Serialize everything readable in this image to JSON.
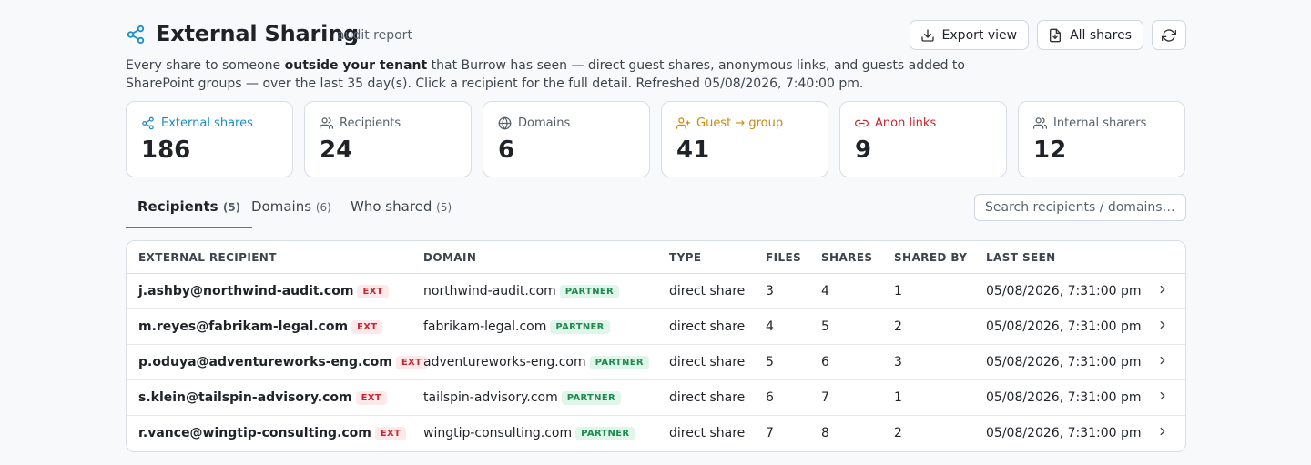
{
  "header": {
    "title": "External Sharing",
    "subtitle": "audit report",
    "export_label": "Export view",
    "all_shares_label": "All shares"
  },
  "description": {
    "part1": "Every share to someone ",
    "bold": "outside your tenant",
    "part2": " that Burrow has seen — direct guest shares, anonymous links, and guests added to SharePoint groups — over the last 35 day(s). Click a recipient for the full detail. Refreshed 05/08/2026, 7:40:00 pm."
  },
  "stats": [
    {
      "label": "External shares",
      "value": "186",
      "color": "#1a8fc7",
      "icon": "share-icon"
    },
    {
      "label": "Recipients",
      "value": "24",
      "color": "#57606a",
      "icon": "users-icon"
    },
    {
      "label": "Domains",
      "value": "6",
      "color": "#57606a",
      "icon": "globe-icon"
    },
    {
      "label": "Guest → group",
      "value": "41",
      "color": "#c98a0d",
      "icon": "user-plus-icon"
    },
    {
      "label": "Anon links",
      "value": "9",
      "color": "#c62832",
      "icon": "link-icon"
    },
    {
      "label": "Internal sharers",
      "value": "12",
      "color": "#57606a",
      "icon": "users-icon"
    }
  ],
  "tabs": [
    {
      "label": "Recipients",
      "count": "(5)",
      "active": true
    },
    {
      "label": "Domains",
      "count": "(6)",
      "active": false
    },
    {
      "label": "Who shared",
      "count": "(5)",
      "active": false
    }
  ],
  "search": {
    "placeholder": "Search recipients / domains…"
  },
  "table": {
    "columns": [
      "EXTERNAL RECIPIENT",
      "DOMAIN",
      "TYPE",
      "FILES",
      "SHARES",
      "SHARED BY",
      "LAST SEEN"
    ],
    "ext_badge": "EXT",
    "partner_badge": "PARTNER",
    "rows": [
      {
        "email": "j.ashby@northwind-audit.com",
        "domain": "northwind-audit.com",
        "type": "direct share",
        "files": "3",
        "shares": "4",
        "shared_by": "1",
        "last_seen": "05/08/2026, 7:31:00 pm"
      },
      {
        "email": "m.reyes@fabrikam-legal.com",
        "domain": "fabrikam-legal.com",
        "type": "direct share",
        "files": "4",
        "shares": "5",
        "shared_by": "2",
        "last_seen": "05/08/2026, 7:31:00 pm"
      },
      {
        "email": "p.oduya@adventureworks-eng.com",
        "domain": "adventureworks-eng.com",
        "type": "direct share",
        "files": "5",
        "shares": "6",
        "shared_by": "3",
        "last_seen": "05/08/2026, 7:31:00 pm"
      },
      {
        "email": "s.klein@tailspin-advisory.com",
        "domain": "tailspin-advisory.com",
        "type": "direct share",
        "files": "6",
        "shares": "7",
        "shared_by": "1",
        "last_seen": "05/08/2026, 7:31:00 pm"
      },
      {
        "email": "r.vance@wingtip-consulting.com",
        "domain": "wingtip-consulting.com",
        "type": "direct share",
        "files": "7",
        "shares": "8",
        "shared_by": "2",
        "last_seen": "05/08/2026, 7:31:00 pm"
      }
    ]
  }
}
